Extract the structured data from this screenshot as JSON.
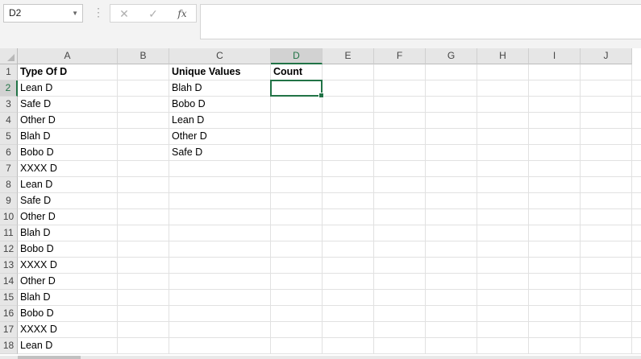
{
  "name_box": {
    "value": "D2",
    "arrow_icon": "chevron-down-icon"
  },
  "formula_bar": {
    "dots": "⋮",
    "cancel_icon": "close-icon",
    "enter_icon": "check-icon",
    "fx_label": "fx",
    "formula": ""
  },
  "grid": {
    "active_cell": "D2",
    "columns": [
      "A",
      "B",
      "C",
      "D",
      "E",
      "F",
      "G",
      "H",
      "I",
      "J"
    ],
    "rows": [
      "1",
      "2",
      "3",
      "4",
      "5",
      "6",
      "7",
      "8",
      "9",
      "10",
      "11",
      "12",
      "13",
      "14",
      "15",
      "16",
      "17",
      "18"
    ],
    "cells": [
      [
        "Type Of D",
        "",
        "Unique Values",
        "Count"
      ],
      [
        "Lean D",
        "",
        "Blah D",
        ""
      ],
      [
        "Safe D",
        "",
        "Bobo D",
        ""
      ],
      [
        "Other D",
        "",
        "Lean D",
        ""
      ],
      [
        "Blah D",
        "",
        "Other D",
        ""
      ],
      [
        "Bobo D",
        "",
        "Safe D",
        ""
      ],
      [
        "XXXX D",
        "",
        "",
        ""
      ],
      [
        "Lean D",
        "",
        "",
        ""
      ],
      [
        "Safe D",
        "",
        "",
        ""
      ],
      [
        "Other D",
        "",
        "",
        ""
      ],
      [
        "Blah D",
        "",
        "",
        ""
      ],
      [
        "Bobo D",
        "",
        "",
        ""
      ],
      [
        "XXXX D",
        "",
        "",
        ""
      ],
      [
        "Other D",
        "",
        "",
        ""
      ],
      [
        "Blah D",
        "",
        "",
        ""
      ],
      [
        "Bobo D",
        "",
        "",
        ""
      ],
      [
        "XXXX D",
        "",
        "",
        ""
      ],
      [
        "Lean D",
        "",
        "",
        ""
      ]
    ]
  },
  "colors": {
    "accent": "#217346"
  }
}
